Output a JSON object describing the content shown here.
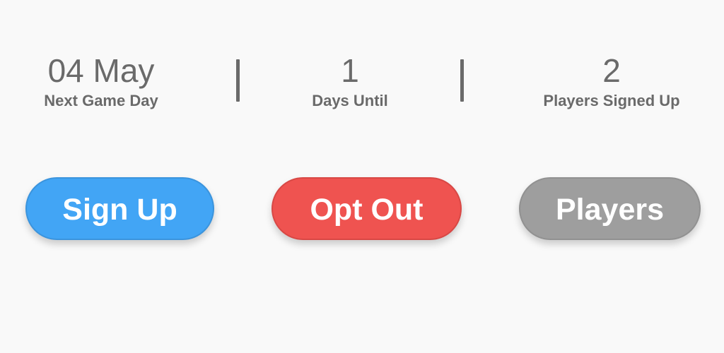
{
  "stats": {
    "next_game": {
      "value": "04 May",
      "label": "Next Game Day"
    },
    "days_until": {
      "value": "1",
      "label": "Days Until"
    },
    "players_signed": {
      "value": "2",
      "label": "Players Signed Up"
    }
  },
  "buttons": {
    "sign_up": "Sign Up",
    "opt_out": "Opt Out",
    "players": "Players"
  },
  "colors": {
    "background": "#f9f9f9",
    "text": "#6a6a6a",
    "sign_up": "#42a5f5",
    "opt_out": "#ef5350",
    "players": "#9e9e9e"
  }
}
